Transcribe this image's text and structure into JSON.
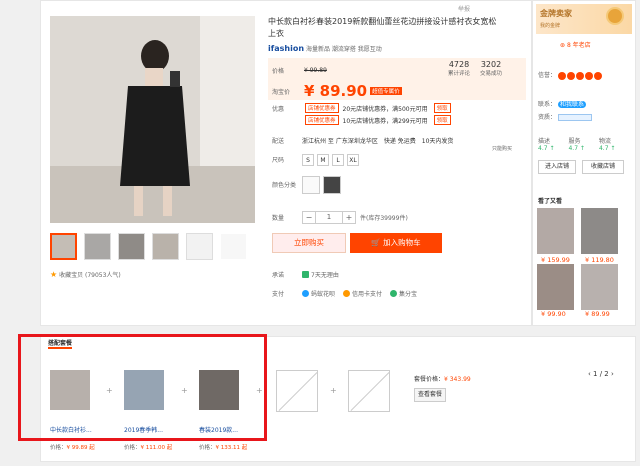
{
  "corner_text": "举报",
  "product": {
    "title": "中长款白衬衫春装2019新款翻仙蕾丝花边拼接设计感衬衣女宽松上衣",
    "brand_logo": "ifashion",
    "brand_tagline": "海量新品 潮流穿搭 我愿互动",
    "favorite_text": "收藏宝贝 (79053人气)"
  },
  "price": {
    "label": "价格",
    "original": "¥ 99.89",
    "taobao_label": "淘宝价",
    "current": "¥ 89.90",
    "current_tag": "超值专属价",
    "stats": [
      {
        "value": "4728",
        "label": "累计评论"
      },
      {
        "value": "3202",
        "label": "交易成功"
      }
    ],
    "promo_label": "优惠",
    "coupons": [
      {
        "tag": "店铺优惠券",
        "text": "20元店铺优惠券，满500元可用",
        "action": "领取"
      },
      {
        "tag": "店铺优惠券",
        "text": "10元店铺优惠券，满299元可用",
        "action": "领取"
      }
    ]
  },
  "shipping": {
    "label": "配送",
    "text": "浙江杭州 至 广东深圳龙华区",
    "method": "快递 免运费",
    "time": "10天内发货",
    "note": "只能购买"
  },
  "options": {
    "size_label": "尺码",
    "sizes": [
      "S",
      "M",
      "L",
      "XL"
    ],
    "color_label": "颜色分类",
    "qty_label": "数量",
    "qty": "1",
    "qty_minus": "−",
    "qty_plus": "+",
    "stock": "件(库存39999件)"
  },
  "actions": {
    "buy": "立即购买",
    "cart": "加入购物车"
  },
  "services": {
    "promise_label": "承诺",
    "promise": "7天无理由",
    "pay_label": "支付",
    "pays": [
      "蚂蚁花呗",
      "信用卡支付",
      "集分宝"
    ]
  },
  "shop": {
    "badge": "金牌卖家",
    "badge_small": "我的金牌",
    "years": "8 年老店",
    "credit_label": "信誉：",
    "contact_label": "联系：",
    "contact": "和我联系",
    "qual_label": "资质：",
    "scores": [
      {
        "label": "描述",
        "value": "4.7 ↑"
      },
      {
        "label": "服务",
        "value": "4.7 ↑"
      },
      {
        "label": "物流",
        "value": "4.7 ↑"
      }
    ],
    "btn_enter": "进入店铺",
    "btn_fav": "收藏店铺",
    "also_viewed": "看了又看",
    "rec_prices": [
      "¥ 159.99",
      "¥ 119.80",
      "¥ 99.90",
      "¥ 89.99"
    ]
  },
  "bundle": {
    "header": "搭配套餐",
    "items": [
      {
        "name": "中长款白衬衫...",
        "price_label": "价格：",
        "price": "¥ 99.89 起"
      },
      {
        "name": "2019春季韩...",
        "price_label": "价格：",
        "price": "¥ 111.00 起"
      },
      {
        "name": "春装2019款...",
        "price_label": "价格：",
        "price": "¥ 133.11 起"
      }
    ],
    "plus": "+",
    "set_price_label": "套餐价格：",
    "set_price": "¥ 343.99",
    "view_button": "查看套餐",
    "pager": "1 / 2"
  },
  "highlight_color": "#e8161b",
  "accent_color": "#ff4400"
}
